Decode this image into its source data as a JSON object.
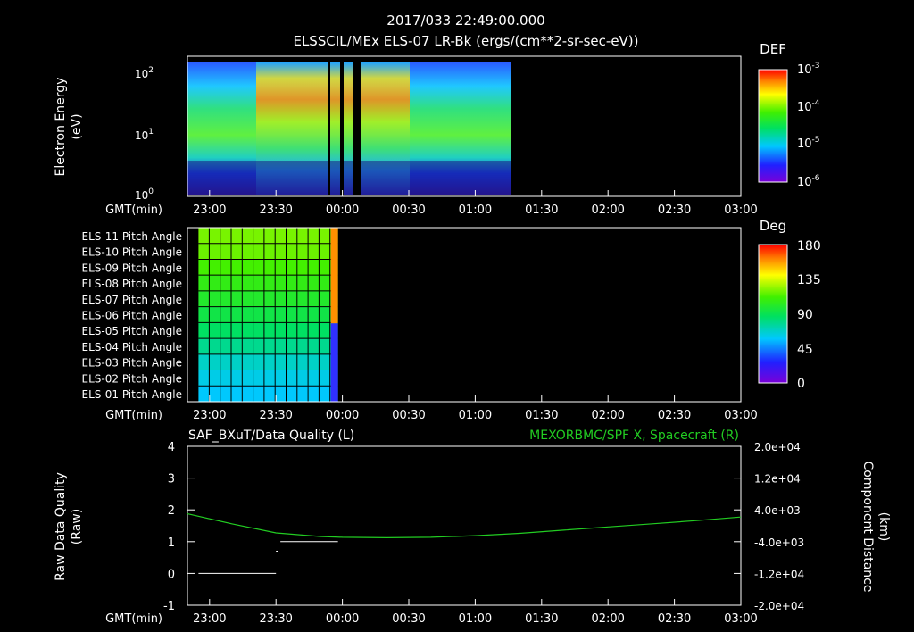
{
  "header": {
    "title": "2017/033 22:49:00.000",
    "subtitle": "ELSSCIL/MEx ELS-07 LR-Bk  (ergs/(cm**2-sr-sec-eV))"
  },
  "colors": {
    "background": "#000000",
    "axes": "#ffffff",
    "green_trace": "#22cc22",
    "green_title": "#22cc22"
  },
  "time_axis": {
    "label": "GMT(min)",
    "ticks": [
      "23:00",
      "23:30",
      "00:00",
      "00:30",
      "01:00",
      "01:30",
      "02:00",
      "02:30",
      "03:00"
    ]
  },
  "chart_data": [
    {
      "type": "heatmap",
      "name": "electron-energy-spectrogram",
      "title": "ELSSCIL/MEx ELS-07 LR-Bk  (ergs/(cm**2-sr-sec-eV))",
      "ylabel": [
        "Electron Energy",
        "(eV)"
      ],
      "xlabel": "GMT(min)",
      "y_scale": "log",
      "y_ticks": [
        "10",
        "10",
        "10"
      ],
      "y_tick_exponents": [
        "2",
        "1",
        "0"
      ],
      "ylim": [
        1,
        150
      ],
      "x_start_minutes": -70,
      "x_end_minutes": 180,
      "data_end_minutes": 77,
      "colorbar": {
        "label": "DEF",
        "scale": "log",
        "ticks": [
          "10",
          "10",
          "10",
          "10"
        ],
        "tick_exponents": [
          "-3",
          "-4",
          "-5",
          "-6"
        ]
      },
      "gaps_minutes": [
        -13,
        -2,
        6
      ]
    },
    {
      "type": "heatmap",
      "name": "pitch-angle-panel",
      "row_labels": [
        "ELS-11 Pitch Angle",
        "ELS-10 Pitch Angle",
        "ELS-09 Pitch Angle",
        "ELS-08 Pitch Angle",
        "ELS-07 Pitch Angle",
        "ELS-06 Pitch Angle",
        "ELS-05 Pitch Angle",
        "ELS-04 Pitch Angle",
        "ELS-03 Pitch Angle",
        "ELS-02 Pitch Angle",
        "ELS-01 Pitch Angle"
      ],
      "row_values_deg": [
        120,
        118,
        112,
        106,
        100,
        93,
        86,
        78,
        68,
        62,
        58
      ],
      "xlabel": "GMT(min)",
      "data_start_minutes": -65,
      "data_end_minutes": -2,
      "colorbar": {
        "label": "Deg",
        "ticks": [
          "180",
          "135",
          "90",
          "45",
          "0"
        ],
        "range": [
          0,
          180
        ]
      }
    },
    {
      "type": "line",
      "name": "data-quality-and-position",
      "title_left": "SAF_BXuT/Data Quality (L)",
      "title_right": "MEXORBMC/SPF X, Spacecraft (R)",
      "ylabel_left": [
        "Raw Data Quality",
        "(Raw)"
      ],
      "ylabel_right": [
        "Component Distance",
        "(km)"
      ],
      "xlabel": "GMT(min)",
      "left_ylim": [
        -1,
        4
      ],
      "left_ticks": [
        "4",
        "3",
        "2",
        "1",
        "0",
        "-1"
      ],
      "right_ylim": [
        -20000,
        20000
      ],
      "right_ticks": [
        "2.0e+04",
        "1.2e+04",
        "4.0e+03",
        "-4.0e+03",
        "-1.2e+04",
        "-2.0e+04"
      ],
      "series": [
        {
          "name": "MEXORBMC/SPF X, Spacecraft (R)",
          "axis": "right",
          "x_minutes": [
            -70,
            -50,
            -30,
            -10,
            0,
            20,
            40,
            60,
            80,
            100,
            120,
            140,
            160,
            180
          ],
          "values": [
            3000,
            500,
            -1800,
            -2700,
            -2900,
            -3000,
            -2900,
            -2500,
            -1900,
            -1100,
            -300,
            500,
            1300,
            2200
          ]
        },
        {
          "name": "SAF_BXuT/Data Quality (L)",
          "axis": "left",
          "segments": [
            {
              "x_start": -65,
              "x_end": -30,
              "y": 0
            },
            {
              "x_start": -30,
              "x_end": -29,
              "y": 0.7
            },
            {
              "x_start": -28,
              "x_end": -2,
              "y": 1
            }
          ]
        }
      ]
    }
  ]
}
